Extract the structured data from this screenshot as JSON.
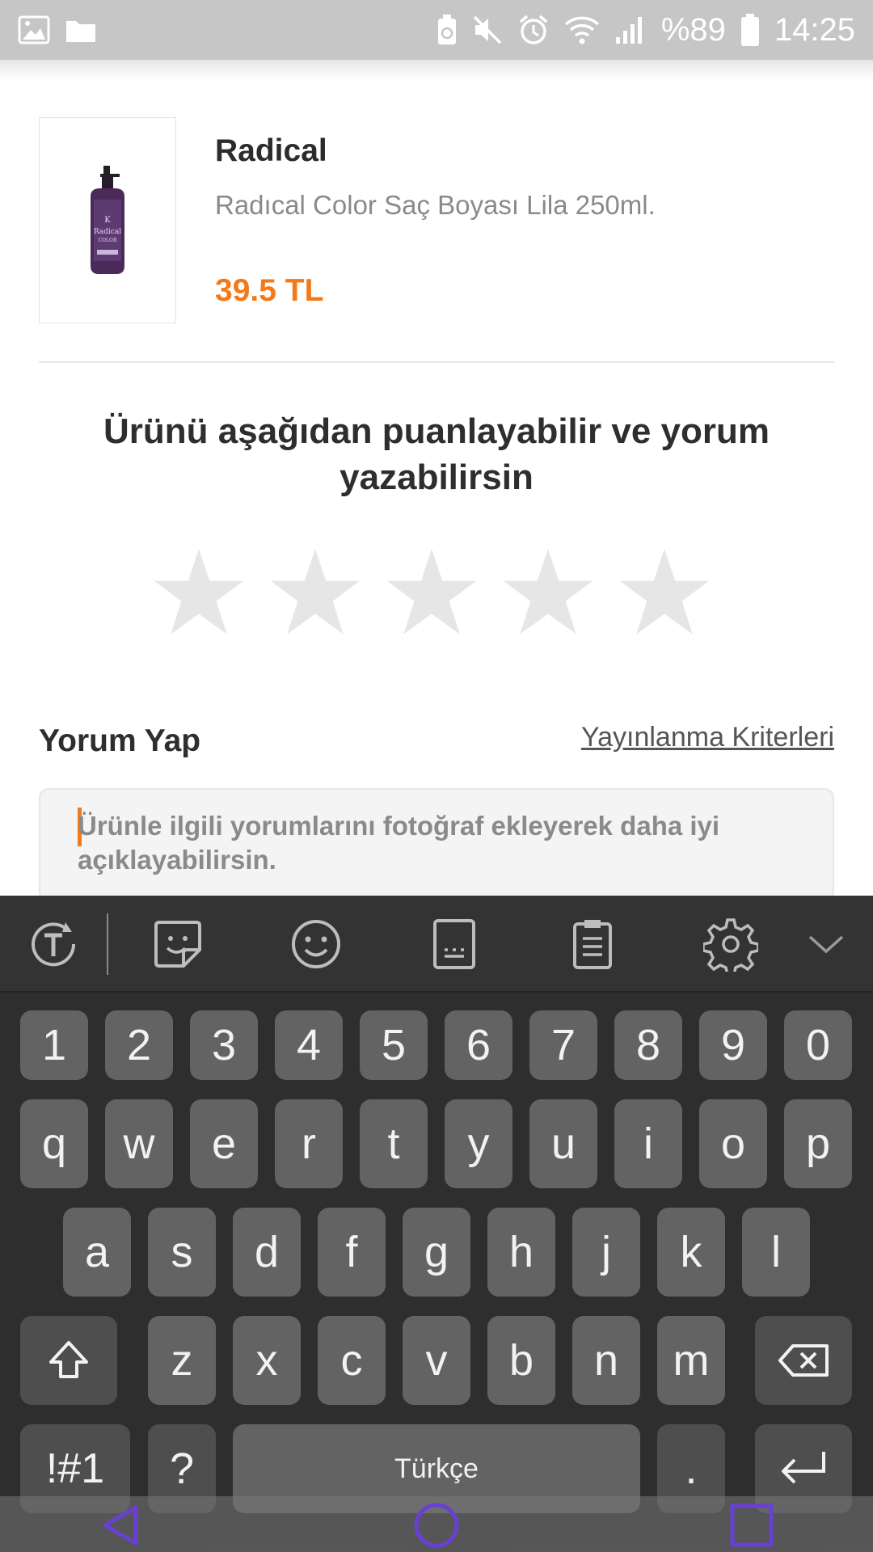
{
  "status_bar": {
    "battery_percent": "%89",
    "time": "14:25",
    "icons": [
      "gallery-icon",
      "folder-icon",
      "battery-saver-icon",
      "mute-icon",
      "alarm-icon",
      "wifi-icon",
      "signal-icon",
      "battery-icon"
    ]
  },
  "product": {
    "brand": "Radical",
    "name": "Radıcal Color Saç Boyası Lila 250ml.",
    "price": "39.5 TL",
    "image_icon": "product-bottle-icon"
  },
  "rating": {
    "title": "Ürünü aşağıdan puanlayabilir ve yorum yazabilirsin",
    "stars_total": 5,
    "stars_selected": 0,
    "star_color": "#e6e6e6"
  },
  "review": {
    "title": "Yorum Yap",
    "criteria_link": "Yayınlanma Kriterleri",
    "placeholder": "Ürünle ilgili yorumlarını fotoğraf ekleyerek daha iyi açıklayabilirsin."
  },
  "keyboard": {
    "toolbar_icons": [
      "text-translate-icon",
      "sticker-icon",
      "emoji-icon",
      "keyboard-layout-icon",
      "clipboard-icon",
      "settings-icon",
      "chevron-down-icon"
    ],
    "row_numbers": [
      "1",
      "2",
      "3",
      "4",
      "5",
      "6",
      "7",
      "8",
      "9",
      "0"
    ],
    "row_1": [
      "q",
      "w",
      "e",
      "r",
      "t",
      "y",
      "u",
      "i",
      "o",
      "p"
    ],
    "row_2": [
      "a",
      "s",
      "d",
      "f",
      "g",
      "h",
      "j",
      "k",
      "l"
    ],
    "row_3": [
      "z",
      "x",
      "c",
      "v",
      "b",
      "n",
      "m"
    ],
    "symbols_key": "!#1",
    "question_key": "?",
    "space_label": "Türkçe",
    "period_key": ".",
    "shift_icon": "shift-icon",
    "backspace_icon": "backspace-icon",
    "enter_icon": "enter-icon"
  },
  "nav_bar": {
    "icons": [
      "back-icon",
      "home-icon",
      "recents-icon"
    ],
    "accent_color": "#6a3fd4"
  },
  "colors": {
    "brand_accent": "#f27a1a",
    "keyboard_bg": "#2e2e2e",
    "key_bg": "#636363"
  }
}
